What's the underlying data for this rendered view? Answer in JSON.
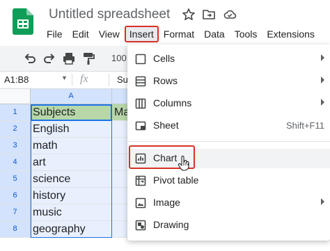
{
  "app": {
    "title": "Untitled spreadsheet",
    "icons": [
      "sheets-logo-icon",
      "star-icon",
      "move-to-folder-icon",
      "cloud-status-icon"
    ]
  },
  "menubar": {
    "items": [
      {
        "label": "File",
        "active": false
      },
      {
        "label": "Edit",
        "active": false
      },
      {
        "label": "View",
        "active": false
      },
      {
        "label": "Insert",
        "active": true
      },
      {
        "label": "Format",
        "active": false
      },
      {
        "label": "Data",
        "active": false
      },
      {
        "label": "Tools",
        "active": false
      },
      {
        "label": "Extensions",
        "active": false
      }
    ]
  },
  "toolbar": {
    "icons": [
      "undo-icon",
      "redo-icon",
      "print-icon",
      "paint-format-icon"
    ],
    "zoom": "100"
  },
  "formula_bar": {
    "name_box": "A1:B8",
    "fx": "fx",
    "content": "Subje"
  },
  "grid": {
    "columns": [
      "A",
      ""
    ],
    "rows": [
      {
        "num": "1",
        "a": "Subjects",
        "b": "Ma"
      },
      {
        "num": "2",
        "a": "English",
        "b": ""
      },
      {
        "num": "3",
        "a": "math",
        "b": ""
      },
      {
        "num": "4",
        "a": "art",
        "b": ""
      },
      {
        "num": "5",
        "a": "science",
        "b": ""
      },
      {
        "num": "6",
        "a": "history",
        "b": ""
      },
      {
        "num": "7",
        "a": "music",
        "b": ""
      },
      {
        "num": "8",
        "a": "geography",
        "b": ""
      }
    ]
  },
  "insert_menu": {
    "items": [
      {
        "label": "Cells",
        "icon": "cells-icon",
        "submenu": true
      },
      {
        "label": "Rows",
        "icon": "rows-icon",
        "submenu": true
      },
      {
        "label": "Columns",
        "icon": "columns-icon",
        "submenu": true
      },
      {
        "label": "Sheet",
        "icon": "sheet-icon",
        "shortcut": "Shift+F11"
      },
      {
        "label": "Chart",
        "icon": "chart-icon",
        "highlighted": true
      },
      {
        "label": "Pivot table",
        "icon": "pivot-table-icon"
      },
      {
        "label": "Image",
        "icon": "image-icon",
        "submenu": true
      },
      {
        "label": "Drawing",
        "icon": "drawing-icon"
      }
    ]
  },
  "colors": {
    "accent_red": "#d93025",
    "selection_blue": "#1a73e8",
    "header_green": "#b7d7a8",
    "sheets_green": "#0f9d58"
  }
}
